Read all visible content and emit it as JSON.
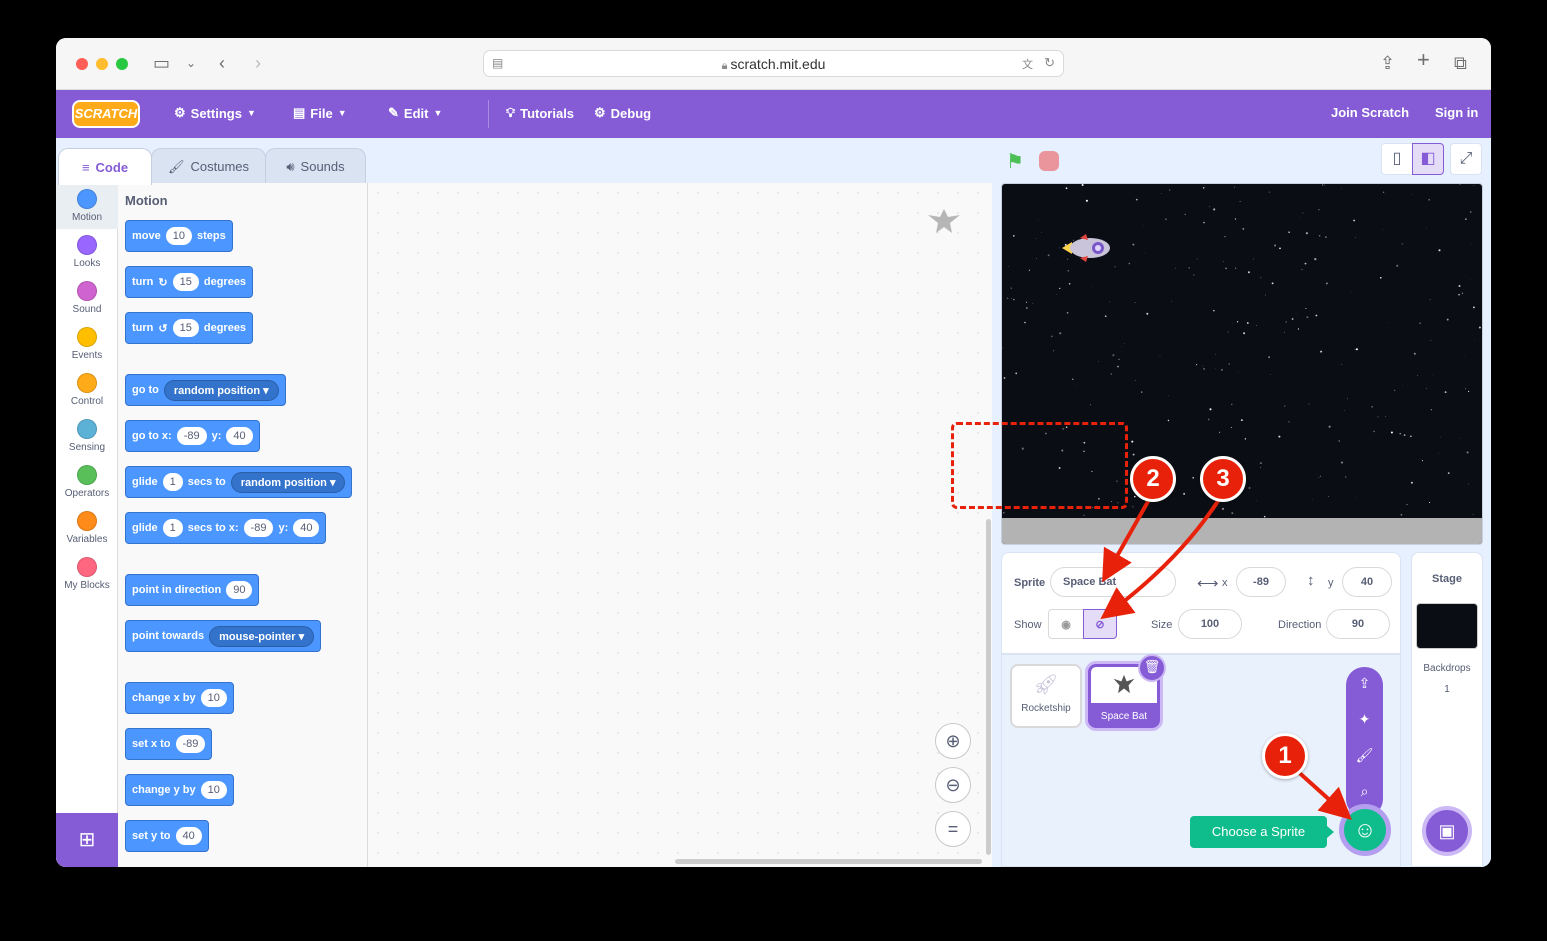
{
  "browser": {
    "url": "scratch.mit.edu"
  },
  "menu": {
    "logo": "SCRATCH",
    "settings": "Settings",
    "file": "File",
    "edit": "Edit",
    "tutorials": "Tutorials",
    "debug": "Debug",
    "join": "Join Scratch",
    "signin": "Sign in"
  },
  "tabs": {
    "code": "Code",
    "costumes": "Costumes",
    "sounds": "Sounds"
  },
  "categories": [
    {
      "label": "Motion",
      "color": "#4c97ff"
    },
    {
      "label": "Looks",
      "color": "#9966ff"
    },
    {
      "label": "Sound",
      "color": "#cf63cf"
    },
    {
      "label": "Events",
      "color": "#ffbf00"
    },
    {
      "label": "Control",
      "color": "#ffab19"
    },
    {
      "label": "Sensing",
      "color": "#5cb1d6"
    },
    {
      "label": "Operators",
      "color": "#59c059"
    },
    {
      "label": "Variables",
      "color": "#ff8c1a"
    },
    {
      "label": "My Blocks",
      "color": "#ff6680"
    }
  ],
  "palette": {
    "title": "Motion",
    "move": {
      "a": "move",
      "v": "10",
      "b": "steps"
    },
    "turn_right": {
      "a": "turn",
      "v": "15",
      "b": "degrees"
    },
    "turn_left": {
      "a": "turn",
      "v": "15",
      "b": "degrees"
    },
    "goto": {
      "a": "go to",
      "dd": "random position"
    },
    "gotoxy": {
      "a": "go to x:",
      "x": "-89",
      "b": "y:",
      "y": "40"
    },
    "glide": {
      "a": "glide",
      "v": "1",
      "b": "secs to",
      "dd": "random position"
    },
    "glidexy": {
      "a": "glide",
      "v": "1",
      "b": "secs to x:",
      "x": "-89",
      "c": "y:",
      "y": "40"
    },
    "point": {
      "a": "point in direction",
      "v": "90"
    },
    "towards": {
      "a": "point towards",
      "dd": "mouse-pointer"
    },
    "changex": {
      "a": "change x by",
      "v": "10"
    },
    "setx": {
      "a": "set x to",
      "v": "-89"
    },
    "changey": {
      "a": "change y by",
      "v": "10"
    },
    "sety": {
      "a": "set y to",
      "v": "40"
    }
  },
  "sprite": {
    "label": "Sprite",
    "name": "Space Bat",
    "x_label": "x",
    "x": "-89",
    "y_label": "y",
    "y": "40",
    "show_label": "Show",
    "size_label": "Size",
    "size": "100",
    "direction_label": "Direction",
    "direction": "90"
  },
  "sprites": [
    {
      "name": "Rocketship"
    },
    {
      "name": "Space Bat"
    }
  ],
  "stage_panel": {
    "title": "Stage",
    "backdrops_label": "Backdrops",
    "backdrops_count": "1"
  },
  "tooltip": "Choose a Sprite",
  "annotations": [
    "1",
    "2",
    "3"
  ],
  "colors": {
    "scratch_purple": "#855cd6",
    "motion_blue": "#4c97ff",
    "annotation_red": "#e8220a",
    "sprite_green": "#0fbd8c"
  }
}
